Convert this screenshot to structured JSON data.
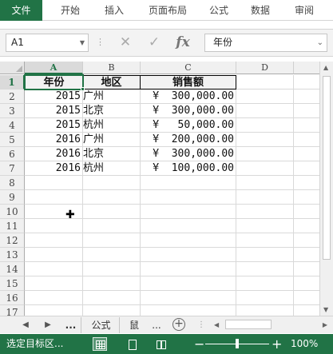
{
  "ribbon": {
    "tabs": [
      "文件",
      "开始",
      "插入",
      "页面布局",
      "公式",
      "数据",
      "审阅"
    ],
    "active_tab": "文件",
    "accent_color": "#217346"
  },
  "formula_bar": {
    "name_box": "A1",
    "formula_value": "年份",
    "fx_label": "fx",
    "cancel_icon": "close-icon",
    "enter_icon": "check-icon"
  },
  "grid": {
    "columns": [
      "A",
      "B",
      "C",
      "D"
    ],
    "rows": [
      "1",
      "2",
      "3",
      "4",
      "5",
      "6",
      "7",
      "8",
      "9",
      "10",
      "11",
      "12",
      "13",
      "14",
      "15",
      "16",
      "17"
    ],
    "header": [
      "年份",
      "地区",
      "销售额"
    ],
    "data": [
      [
        "2015",
        "广州",
        "¥  300,000.00"
      ],
      [
        "2015",
        "北京",
        "¥  300,000.00"
      ],
      [
        "2015",
        "杭州",
        "¥   50,000.00"
      ],
      [
        "2016",
        "广州",
        "¥  200,000.00"
      ],
      [
        "2016",
        "北京",
        "¥  300,000.00"
      ],
      [
        "2016",
        "杭州",
        "¥  100,000.00"
      ]
    ],
    "selected_cell": "A1",
    "cursor_icon": "plus-cursor-icon"
  },
  "sheets": {
    "tabs": [
      "公式",
      "鼠"
    ],
    "ellipsis_left": "...",
    "ellipsis_right": "...",
    "add_label": "+"
  },
  "status": {
    "text": "选定目标区...",
    "zoom": "100%"
  }
}
